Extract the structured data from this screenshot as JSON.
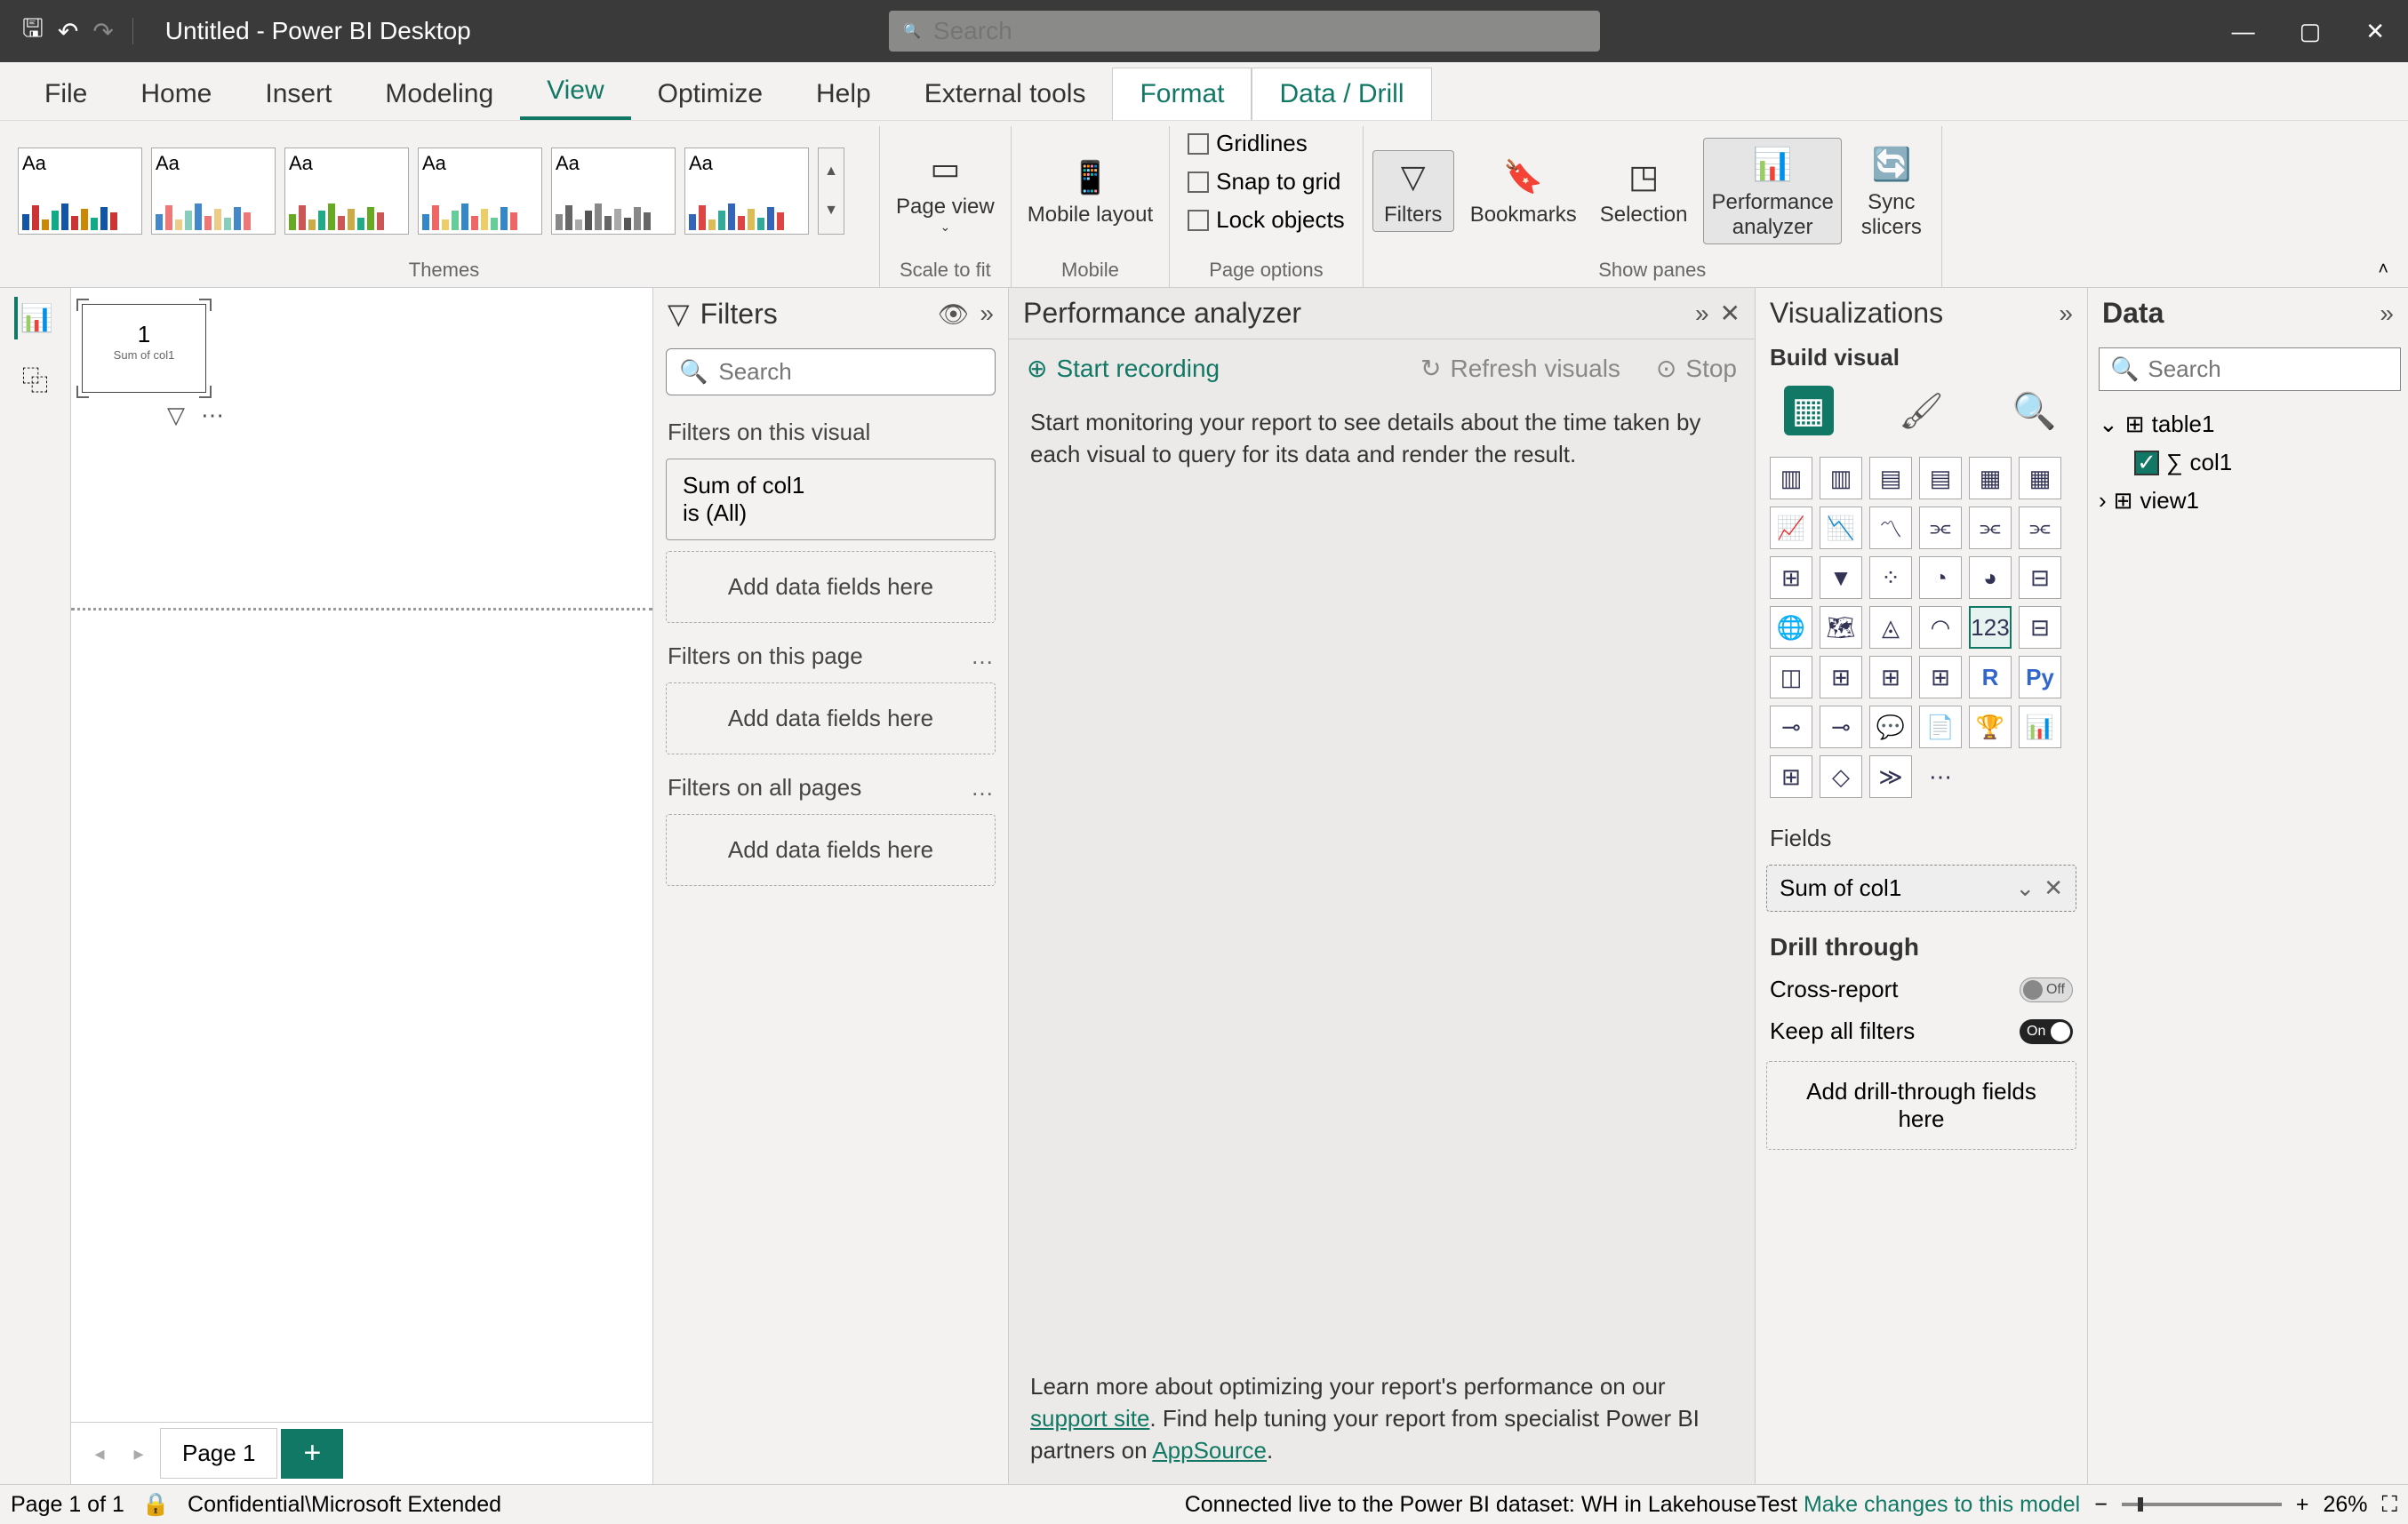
{
  "titlebar": {
    "title": "Untitled - Power BI Desktop",
    "search_placeholder": "Search"
  },
  "ribbon_tabs": {
    "file": "File",
    "home": "Home",
    "insert": "Insert",
    "modeling": "Modeling",
    "view": "View",
    "optimize": "Optimize",
    "help": "Help",
    "external": "External tools",
    "format": "Format",
    "datadrill": "Data / Drill"
  },
  "ribbon": {
    "themes": "Themes",
    "scale": "Scale to fit",
    "mobile": "Mobile",
    "page_options": "Page options",
    "show_panes": "Show panes",
    "page_view": "Page view",
    "mobile_layout": "Mobile layout",
    "gridlines": "Gridlines",
    "snap": "Snap to grid",
    "lock": "Lock objects",
    "filters": "Filters",
    "bookmarks": "Bookmarks",
    "selection": "Selection",
    "perf1": "Performance",
    "perf2": "analyzer",
    "sync1": "Sync",
    "sync2": "slicers"
  },
  "visual": {
    "value": "1",
    "label": "Sum of col1"
  },
  "page_tabs": {
    "page1": "Page 1"
  },
  "filters": {
    "title": "Filters",
    "search_placeholder": "Search",
    "on_visual": "Filters on this visual",
    "card_title": "Sum of col1",
    "card_sub": "is (All)",
    "drop": "Add data fields here",
    "on_page": "Filters on this page",
    "on_all": "Filters on all pages"
  },
  "perf": {
    "title": "Performance analyzer",
    "start": "Start recording",
    "refresh": "Refresh visuals",
    "stop": "Stop",
    "msg": "Start monitoring your report to see details about the time taken by each visual to query for its data and render the result.",
    "foot1": "Learn more about optimizing your report's performance on our ",
    "foot_link1": "support site",
    "foot2": ". Find help tuning your report from specialist Power BI partners on ",
    "foot_link2": "AppSource",
    "foot3": "."
  },
  "viz": {
    "title": "Visualizations",
    "build": "Build visual",
    "fields": "Fields",
    "well": "Sum of col1",
    "drill": "Drill through",
    "cross": "Cross-report",
    "keep": "Keep all filters",
    "drill_drop": "Add drill-through fields here",
    "off": "Off",
    "on": "On"
  },
  "data": {
    "title": "Data",
    "search_placeholder": "Search",
    "table": "table1",
    "col": "col1",
    "view": "view1"
  },
  "status": {
    "page": "Page 1 of 1",
    "conf": "Confidential\\Microsoft Extended",
    "conn": "Connected live to the Power BI dataset: WH in LakehouseTest ",
    "make": "Make changes to this model",
    "zoom": "26%"
  }
}
